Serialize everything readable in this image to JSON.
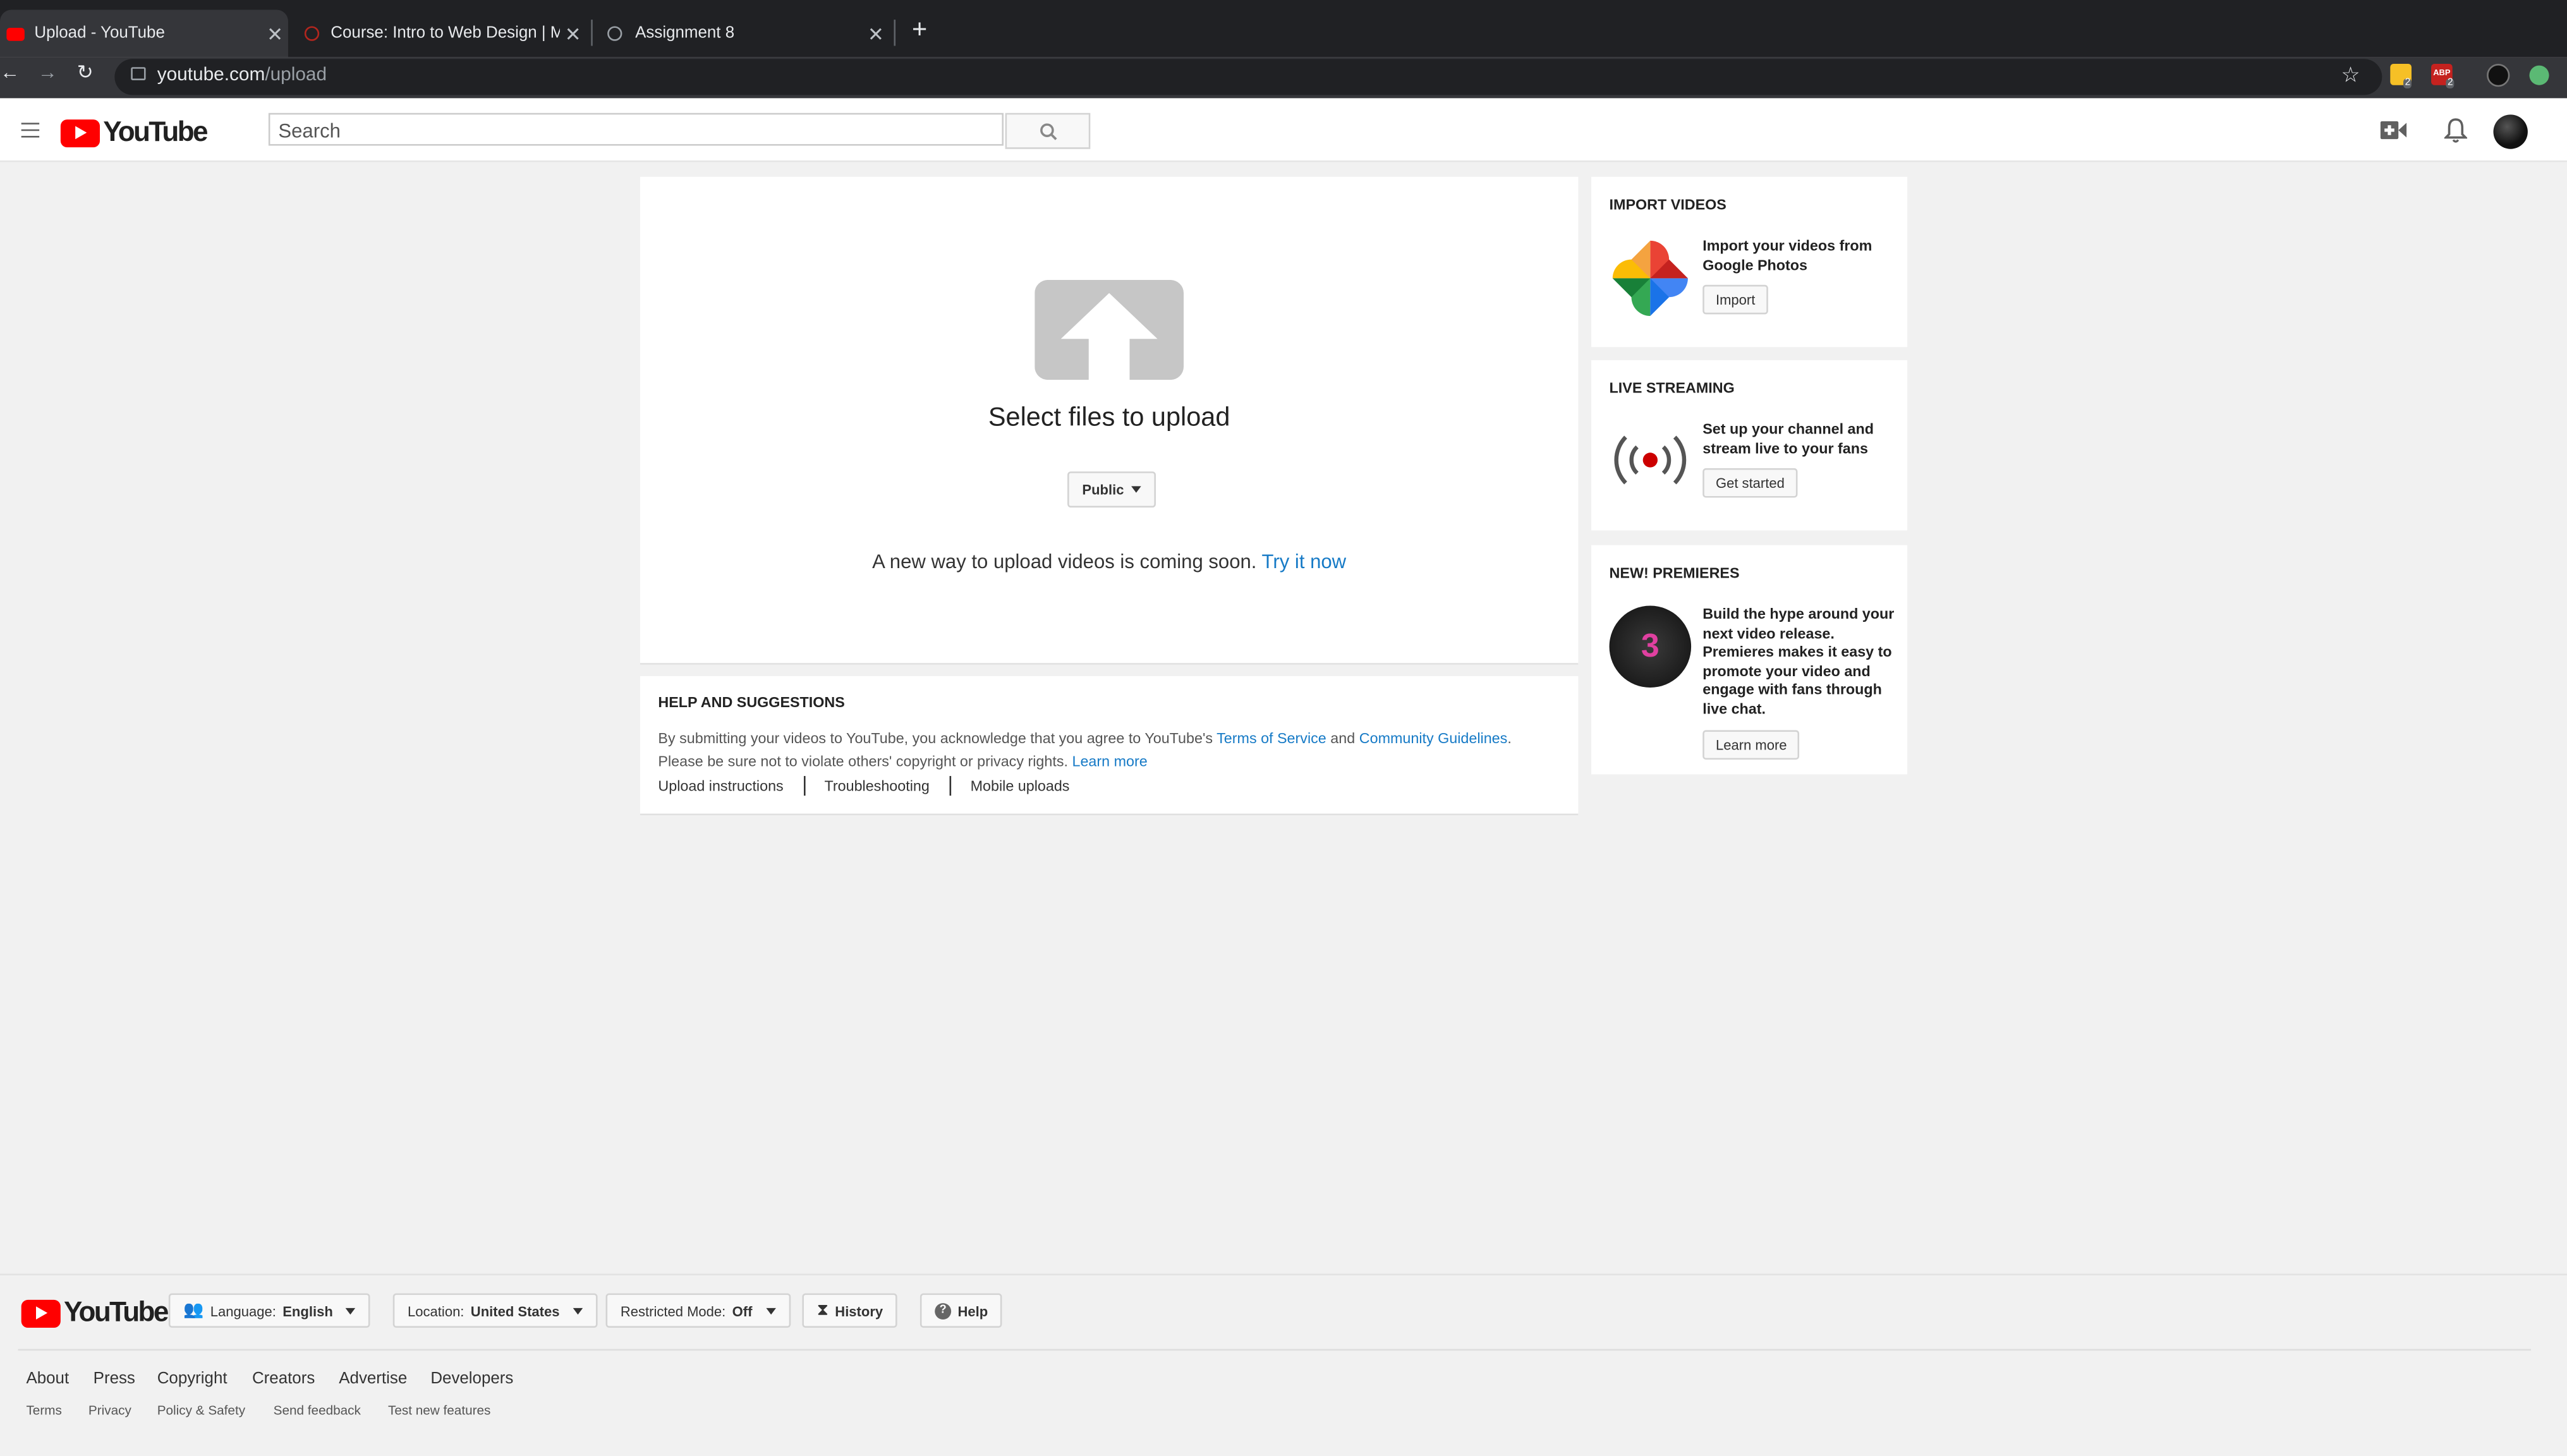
{
  "browser": {
    "tabs": [
      {
        "title": "Upload - YouTube",
        "active": true
      },
      {
        "title": "Course: Intro to Web Design | M",
        "active": false
      },
      {
        "title": "Assignment 8",
        "active": false
      }
    ],
    "new_tab": "+",
    "url_host": "youtube.com",
    "url_path": "/upload",
    "extension_badges": [
      "2",
      "2"
    ],
    "abp_label": "ABP"
  },
  "header": {
    "logo_text": "YouTube",
    "search_placeholder": "Search"
  },
  "upload": {
    "title": "Select files to upload",
    "privacy": "Public",
    "notice": "A new way to upload videos is coming soon.",
    "try_link": "Try it now"
  },
  "help": {
    "heading": "HELP AND SUGGESTIONS",
    "text_1": "By submitting your videos to YouTube, you acknowledge that you agree to YouTube's",
    "tos": "Terms of Service",
    "and": "and",
    "guidelines": "Community Guidelines",
    "period": ".",
    "text_2": "Please be sure not to violate others' copyright or privacy rights.",
    "learn_more": "Learn more",
    "links": [
      "Upload instructions",
      "Troubleshooting",
      "Mobile uploads"
    ]
  },
  "sidebar": {
    "import": {
      "heading": "IMPORT VIDEOS",
      "text": "Import your videos from Google Photos",
      "button": "Import"
    },
    "live": {
      "heading": "LIVE STREAMING",
      "text": "Set up your channel and stream live to your fans",
      "button": "Get started"
    },
    "premieres": {
      "heading": "NEW! PREMIERES",
      "text": "Build the hype around your next video release. Premieres makes it easy to promote your video and engage with fans through live chat.",
      "button": "Learn more",
      "badge_number": "3"
    }
  },
  "footer": {
    "logo_text": "YouTube",
    "language_label": "Language:",
    "language_value": "English",
    "location_label": "Location:",
    "location_value": "United States",
    "restricted_label": "Restricted Mode:",
    "restricted_value": "Off",
    "history": "History",
    "help": "Help",
    "links": [
      "About",
      "Press",
      "Copyright",
      "Creators",
      "Advertise",
      "Developers"
    ],
    "sub_links": [
      "Terms",
      "Privacy",
      "Policy & Safety",
      "Send feedback",
      "Test new features"
    ]
  },
  "colors": {
    "brand_red": "#ff0000",
    "link_blue": "#167ac6",
    "chrome_dark": "#202124"
  }
}
